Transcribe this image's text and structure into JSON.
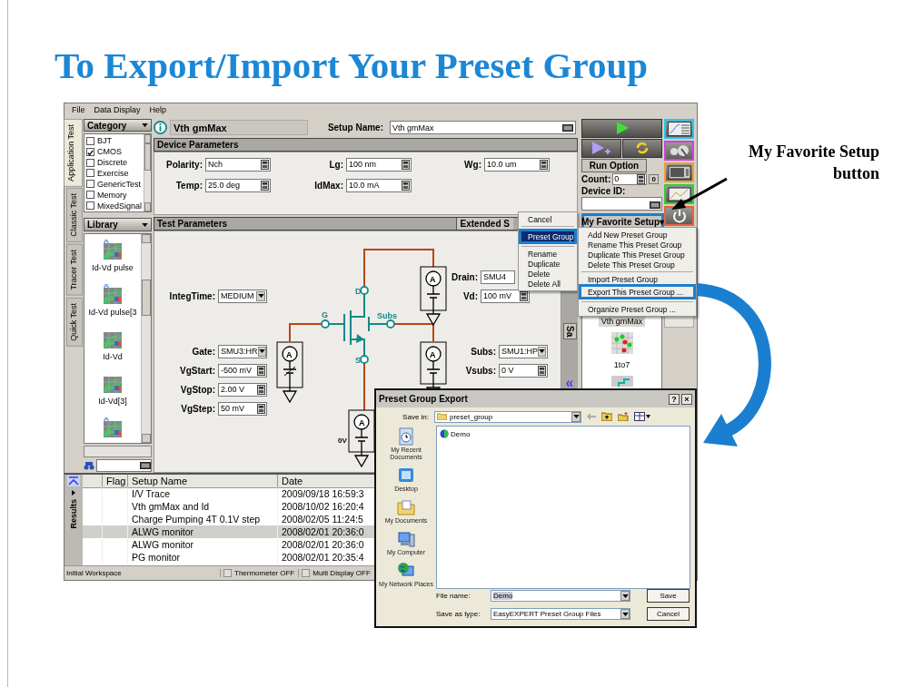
{
  "slide_title": "To Export/Import Your Preset Group",
  "annotation": "My Favorite Setup button",
  "menubar": [
    "File",
    "Data Display",
    "Help"
  ],
  "side_tabs": [
    {
      "label": "Application Test",
      "selected": true
    },
    {
      "label": "Classic Test",
      "selected": false
    },
    {
      "label": "Tracer Test",
      "selected": false
    },
    {
      "label": "Quick Test",
      "selected": false
    }
  ],
  "category": {
    "title": "Category",
    "items": [
      {
        "label": "BJT",
        "checked": false
      },
      {
        "label": "CMOS",
        "checked": true
      },
      {
        "label": "Discrete",
        "checked": false
      },
      {
        "label": "Exercise",
        "checked": false
      },
      {
        "label": "GenericTest",
        "checked": false
      },
      {
        "label": "Memory",
        "checked": false
      },
      {
        "label": "MixedSignal",
        "checked": false
      }
    ]
  },
  "library": {
    "title": "Library",
    "items": [
      "Id-Vd pulse",
      "Id-Vd pulse[3",
      "Id-Vd",
      "Id-Vd[3]"
    ]
  },
  "setup": {
    "title": "Vth gmMax",
    "label": "Setup Name:",
    "value": "Vth gmMax"
  },
  "device_parameters": {
    "title": "Device Parameters",
    "fields": [
      {
        "label": "Polarity:",
        "value": "Nch",
        "kind": "number"
      },
      {
        "label": "Lg:",
        "value": "100 nm",
        "kind": "number"
      },
      {
        "label": "Wg:",
        "value": "10.0 um",
        "kind": "number"
      },
      {
        "label": "Temp:",
        "value": "25.0 deg",
        "kind": "number"
      },
      {
        "label": "IdMax:",
        "value": "10.0 mA",
        "kind": "number"
      }
    ]
  },
  "test_parameters": {
    "title": "Test Parameters",
    "extended": "Extended S",
    "integ_time": {
      "label": "IntegTime:",
      "value": "MEDIUM",
      "kind": "select"
    },
    "gate_fields": [
      {
        "label": "Gate:",
        "value": "SMU3:HR",
        "kind": "select"
      },
      {
        "label": "VgStart:",
        "value": "-500 mV",
        "kind": "number"
      },
      {
        "label": "VgStop:",
        "value": "2.00 V",
        "kind": "number"
      },
      {
        "label": "VgStep:",
        "value": "50 mV",
        "kind": "number"
      }
    ],
    "drain_fields": [
      {
        "label": "Drain:",
        "value": "SMU4",
        "kind": "text"
      },
      {
        "label": "Vd:",
        "value": "100 mV",
        "kind": "number"
      }
    ],
    "subs_fields": [
      {
        "label": "Subs:",
        "value": "SMU1:HP",
        "kind": "select"
      },
      {
        "label": "Vsubs:",
        "value": "0 V",
        "kind": "number"
      }
    ],
    "terminals": [
      "D",
      "G",
      "Subs",
      "S"
    ],
    "meters": [
      "A",
      "A",
      "A",
      "A"
    ],
    "source_reading": "0V"
  },
  "run_panel": {
    "run_option": "Run Option",
    "count_label": "Count:",
    "count": "0",
    "count_button": "0",
    "device_id_label": "Device ID:",
    "favorite": "My Favorite Setup▾",
    "favorite_outlined": true
  },
  "preset_panel": {
    "tab": "Sa",
    "collapse": "«",
    "items": [
      {
        "label": "Vth gmMax",
        "selected": true
      },
      {
        "label": "1to7",
        "selected": false
      }
    ]
  },
  "results": {
    "tab": "Results",
    "columns": [
      "Flag",
      "Setup Name",
      "Date"
    ],
    "rows": [
      {
        "setup_name": "I/V Trace",
        "date": "2009/09/18 16:59:3",
        "selected": false
      },
      {
        "setup_name": "Vth gmMax and Id",
        "date": "2008/10/02 16:20:4",
        "selected": false
      },
      {
        "setup_name": "Charge Pumping 4T 0.1V step",
        "date": "2008/02/05 11:24:5",
        "selected": false
      },
      {
        "setup_name": "ALWG monitor",
        "date": "2008/02/01 20:36:0",
        "selected": true
      },
      {
        "setup_name": "ALWG monitor",
        "date": "2008/02/01 20:36:0",
        "selected": false
      },
      {
        "setup_name": "PG monitor",
        "date": "2008/02/01 20:35:4",
        "selected": false
      }
    ]
  },
  "status_bar": {
    "workspace": "Initial Workspace",
    "toggles": [
      "Thermometer OFF",
      "Multi Display OFF"
    ]
  },
  "context_menu": {
    "groups": [
      [
        {
          "label": "Cancel",
          "selected": false,
          "outlined": false
        }
      ],
      [
        {
          "label": "Preset Group",
          "selected": true,
          "outlined": true
        }
      ],
      [
        {
          "label": "Rename",
          "selected": false,
          "outlined": false
        },
        {
          "label": "Duplicate",
          "selected": false,
          "outlined": false
        },
        {
          "label": "Delete",
          "selected": false,
          "outlined": false
        },
        {
          "label": "Delete All",
          "selected": false,
          "outlined": false
        }
      ]
    ]
  },
  "submenu": {
    "groups": [
      [
        {
          "label": "Add New Preset Group",
          "selected": false,
          "outlined": false
        },
        {
          "label": "Rename This Preset Group",
          "selected": false,
          "outlined": false
        },
        {
          "label": "Duplicate This Preset Group",
          "selected": false,
          "outlined": false
        },
        {
          "label": "Delete This Preset Group",
          "selected": false,
          "outlined": false
        }
      ],
      [
        {
          "label": "Import Preset Group",
          "selected": false,
          "outlined": false
        },
        {
          "label": "Export This Preset Group ...",
          "selected": false,
          "outlined": true
        }
      ],
      [
        {
          "label": "Organize Preset Group ...",
          "selected": false,
          "outlined": false
        }
      ]
    ]
  },
  "dialog": {
    "title": "Preset Group Export",
    "help": "?",
    "close": "×",
    "save_in_label": "Save in:",
    "save_in": "preset_group",
    "places": [
      "My Recent Documents",
      "Desktop",
      "My Documents",
      "My Computer",
      "My Network Places"
    ],
    "files": [
      "Demo"
    ],
    "file_name_label": "File name:",
    "file_name": "Demo",
    "type_label": "Save as type:",
    "type": "EasyEXPERT Preset Group Files",
    "save": "Save",
    "cancel": "Cancel"
  }
}
